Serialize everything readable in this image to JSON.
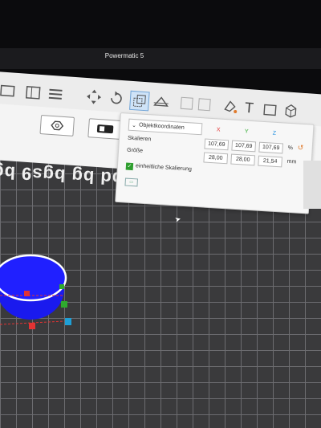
{
  "window": {
    "title": "Powermatic 5"
  },
  "toolbar": {
    "icons": [
      "cube-view-icon",
      "layout-icon",
      "list-icon",
      "move-icon",
      "rotate-icon",
      "scale-icon",
      "cut-icon",
      "support-icon",
      "paint-icon",
      "text-icon",
      "arrange-icon",
      "view-3d-icon"
    ],
    "text_icon_label": "T"
  },
  "view_buttons": [
    "nozzle-view-icon",
    "printer-view-icon"
  ],
  "bed": {
    "label": "Ibd bg bgs9 bg"
  },
  "scale_panel": {
    "coord_system": "Objektkoordinaten",
    "axes": [
      "X",
      "Y",
      "Z"
    ],
    "scale": {
      "label": "Skalieren",
      "x": "107,69",
      "y": "107,69",
      "z": "107,69",
      "unit": "%"
    },
    "size": {
      "label": "Größe",
      "x": "28,00",
      "y": "28,00",
      "z": "21,54",
      "unit": "mm"
    },
    "uniform_scale": {
      "label": "einheitliche Skalierung",
      "checked": true
    },
    "reset_icon": "reset-icon"
  },
  "colors": {
    "model": "#1a1aee",
    "axis_x": "#e23333",
    "axis_y": "#2eaa2e",
    "axis_z": "#1f8fe0"
  }
}
